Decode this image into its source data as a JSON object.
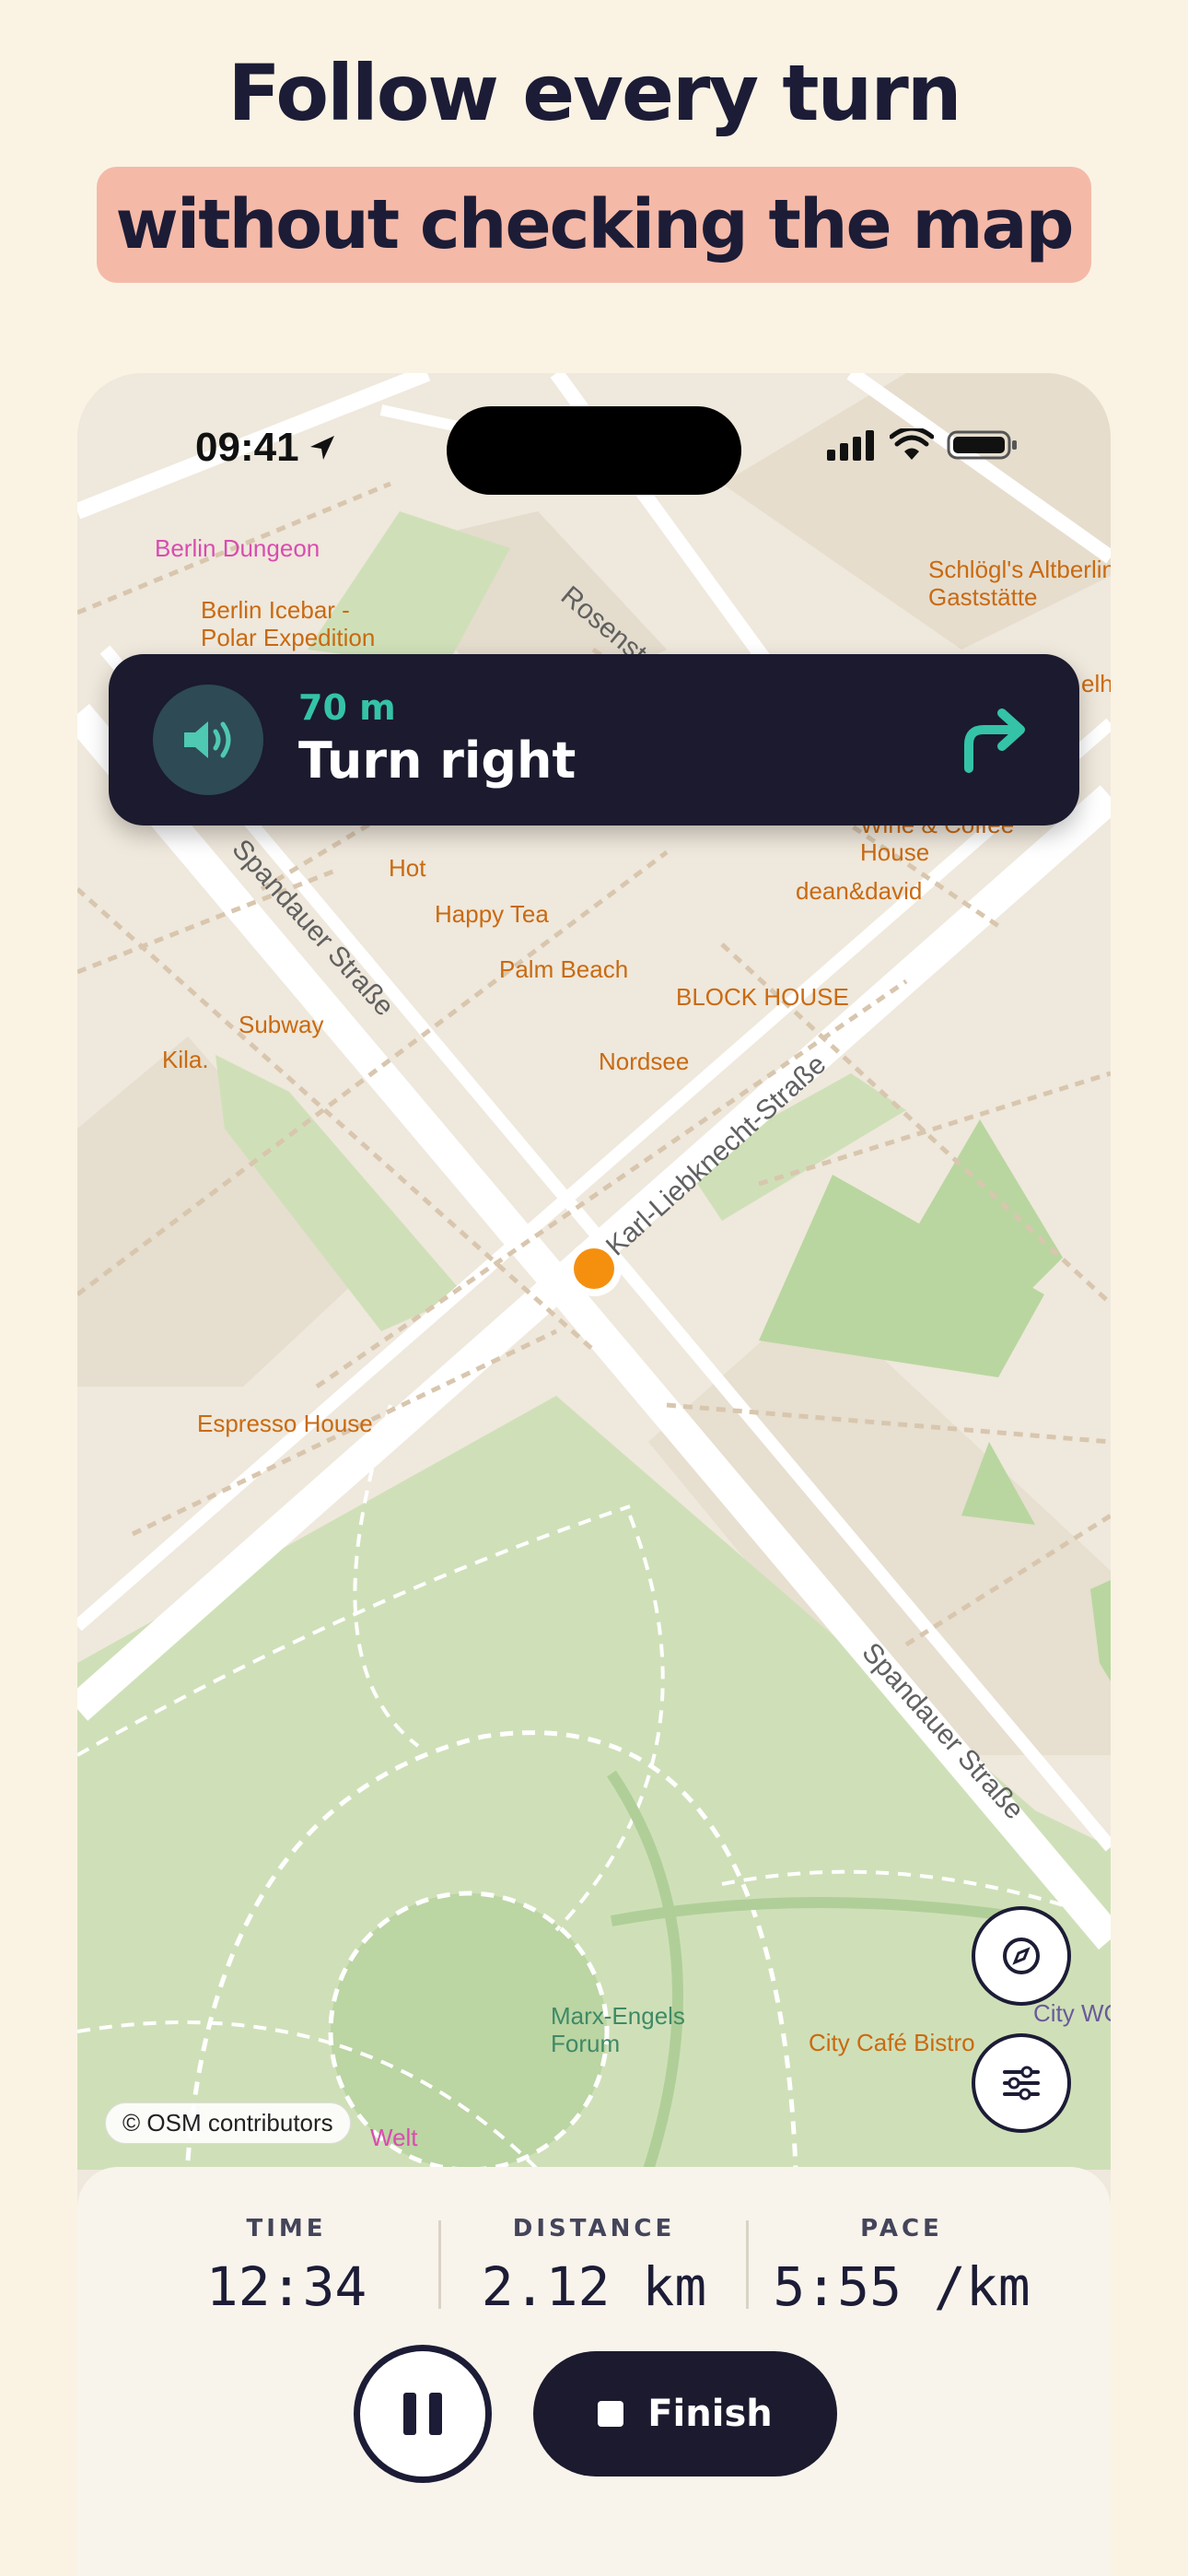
{
  "headline": {
    "line1": "Follow every turn",
    "line2": "without checking the map"
  },
  "status_bar": {
    "time": "09:41",
    "icons": [
      "location-arrow-icon",
      "cellular-signal-icon",
      "wifi-icon",
      "battery-icon"
    ]
  },
  "navigation": {
    "distance": "70 m",
    "instruction": "Turn right",
    "speaker_icon": "speaker-icon",
    "direction_icon": "turn-right-arrow-icon"
  },
  "map": {
    "labels": {
      "berlin_dungeon": "Berlin Dungeon",
      "berlin_icebar_1": "Berlin Icebar -",
      "berlin_icebar_2": "Polar Expedition",
      "rosenstrasse": "Rosenstraße",
      "schloegls_1": "Schlögl's Altberlin",
      "schloegls_2": "Gaststätte",
      "elha": "elha",
      "wine_coffee_1": "Wine & Coffee",
      "wine_coffee_2": "House",
      "dean_david": "dean&david",
      "hot": "Hot",
      "happy_tea": "Happy Tea",
      "palm_beach": "Palm Beach",
      "block_house": "BLOCK HOUSE",
      "subway": "Subway",
      "kila": "Kila.",
      "nordsee": "Nordsee",
      "spandauer_1": "Spandauer Straße",
      "karl_liebknecht": "Karl-Liebknecht-Straße",
      "espresso_house": "Espresso House",
      "spandauer_2": "Spandauer Straße",
      "marx_engels_1": "Marx-Engels",
      "marx_engels_2": "Forum",
      "city_wc": "City WC",
      "city_cafe": "City Café Bistro",
      "welt": "Welt"
    },
    "attribution": "© OSM contributors",
    "buttons": [
      "compass-icon",
      "sliders-icon"
    ]
  },
  "stats": {
    "time_label": "TIME",
    "time_value": "12:34",
    "distance_label": "DISTANCE",
    "distance_value": "2.12 km",
    "pace_label": "PACE",
    "pace_value": "5:55 /km"
  },
  "controls": {
    "finish_label": "Finish"
  },
  "colors": {
    "background": "#faf3e4",
    "highlight": "#f5b9a8",
    "dark": "#1b1a2e",
    "accent": "#34c3a6",
    "location_dot": "#f5900f"
  }
}
